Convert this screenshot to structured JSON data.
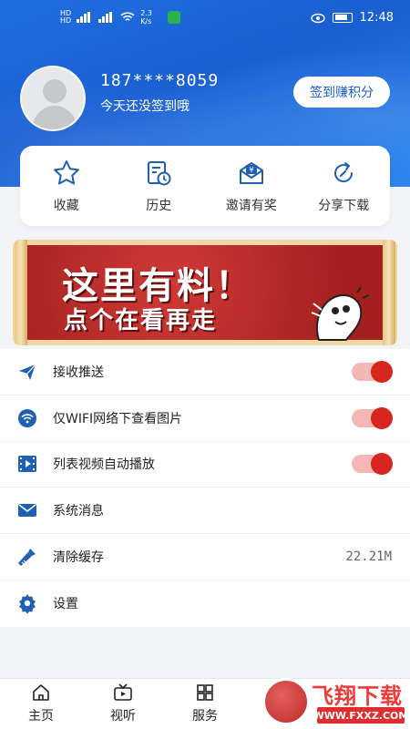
{
  "status_bar": {
    "time": "12:48",
    "net_speed": "2.3 K/s"
  },
  "user": {
    "phone": "187****8059",
    "sign_tip": "今天还没签到哦",
    "checkin_label": "签到赚积分"
  },
  "quick_actions": [
    {
      "label": "收藏",
      "icon": "star-icon"
    },
    {
      "label": "历史",
      "icon": "history-icon"
    },
    {
      "label": "邀请有奖",
      "icon": "invite-gift-icon"
    },
    {
      "label": "分享下载",
      "icon": "share-icon"
    }
  ],
  "banner": {
    "line1": "这里有料！",
    "line2": "点个在看再走"
  },
  "settings": [
    {
      "label": "接收推送",
      "icon": "send-icon",
      "toggle": true,
      "on": true
    },
    {
      "label": "仅WIFI网络下查看图片",
      "icon": "wifi-icon",
      "toggle": true,
      "on": true
    },
    {
      "label": "列表视频自动播放",
      "icon": "video-icon",
      "toggle": true,
      "on": true
    },
    {
      "label": "系统消息",
      "icon": "mail-icon",
      "toggle": false
    },
    {
      "label": "清除缓存",
      "icon": "broom-icon",
      "value": "22.21M"
    },
    {
      "label": "设置",
      "icon": "gear-icon",
      "toggle": false
    }
  ],
  "nav": [
    {
      "label": "主页",
      "icon": "home-icon"
    },
    {
      "label": "视听",
      "icon": "tv-icon"
    },
    {
      "label": "服务",
      "icon": "grid-icon"
    }
  ],
  "watermark": {
    "brand": "飞翔下载",
    "url": "WWW.FXXZ.COM"
  },
  "colors": {
    "primary": "#1a5fd2",
    "toggle_on": "#d7261e",
    "icon_blue": "#1f5fb4"
  }
}
